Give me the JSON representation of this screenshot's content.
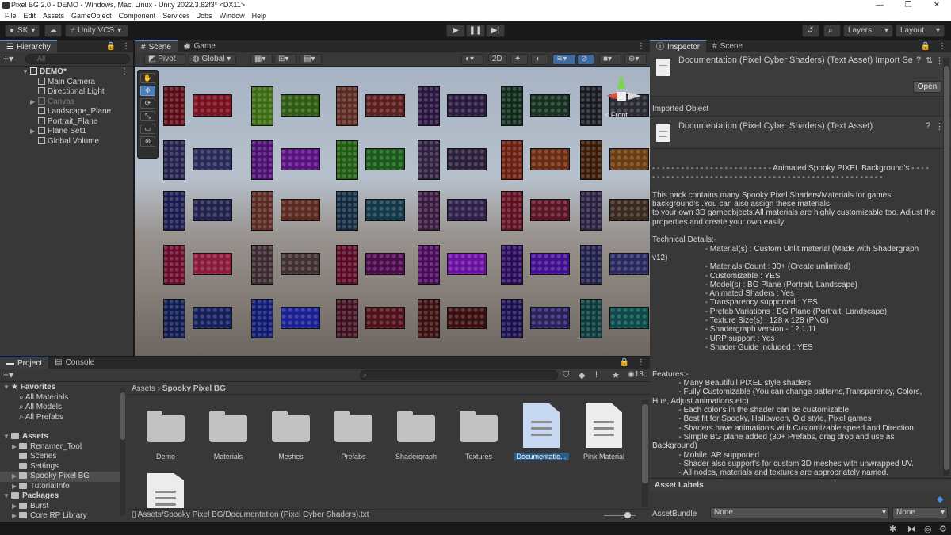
{
  "window": {
    "title": "Pixel BG 2.0 - DEMO - Windows, Mac, Linux - Unity 2022.3.62f3* <DX11>",
    "controls": [
      "—",
      "❐",
      "✕"
    ]
  },
  "menu": [
    "File",
    "Edit",
    "Assets",
    "GameObject",
    "Component",
    "Services",
    "Jobs",
    "Window",
    "Help"
  ],
  "toolbar": {
    "account": "SK",
    "vcs": "Unity VCS",
    "layers": "Layers",
    "layout": "Layout"
  },
  "hierarchy": {
    "tab": "Hierarchy",
    "search_placeholder": "All",
    "root": "DEMO*",
    "items": [
      "Main Camera",
      "Directional Light",
      "Canvas",
      "Landscape_Plane",
      "Portrait_Plane",
      "Plane Set1",
      "Global Volume"
    ]
  },
  "scene": {
    "tabs": [
      "Scene",
      "Game"
    ],
    "pivot": "Pivot",
    "global": "Global",
    "mode_2d": "2D",
    "gizmo_label": "< Front",
    "tiles": [
      [
        "#5a0a14",
        "#7a1020"
      ],
      [
        "#3b6b10",
        "#2e5a12"
      ],
      [
        "#5a2a22",
        "#5c1e1e"
      ],
      [
        "#2a1440",
        "#2b1a3f"
      ],
      [
        "#0f2a1a",
        "#163020"
      ],
      [
        "#1a1a22",
        "#2a2a33"
      ],
      [
        "#24204e",
        "#2a2a5a"
      ],
      [
        "#4a0f70",
        "#5a1080"
      ],
      [
        "#1f5a10",
        "#185a18"
      ],
      [
        "#302040",
        "#2a1f3a"
      ],
      [
        "#6a1f10",
        "#6a2a10"
      ],
      [
        "#3a1a05",
        "#6a3a10"
      ],
      [
        "#1a1a50",
        "#22224e"
      ],
      [
        "#5a2a22",
        "#5a2820"
      ],
      [
        "#122a40",
        "#123848"
      ],
      [
        "#3a1a40",
        "#30204a"
      ],
      [
        "#601020",
        "#5a1525"
      ],
      [
        "#2a2040",
        "#3a2a20"
      ],
      [
        "#6a0a2a",
        "#8a1a3a"
      ],
      [
        "#3a2a30",
        "#403030"
      ],
      [
        "#5a0a25",
        "#4a0a4a"
      ],
      [
        "#4a0a5a",
        "#6a10a0"
      ],
      [
        "#2a0a5a",
        "#401090"
      ],
      [
        "#20204a",
        "#2a2a60"
      ],
      [
        "#0f1a50",
        "#15205a"
      ],
      [
        "#101a70",
        "#1a2090"
      ],
      [
        "#401020",
        "#50101a"
      ],
      [
        "#3a1010",
        "#3a0f10"
      ],
      [
        "#1a1050",
        "#2a2060"
      ],
      [
        "#0a3a3a",
        "#0a4a4a"
      ]
    ]
  },
  "inspector": {
    "tabs": [
      "Inspector",
      "Scene"
    ],
    "header_title": "Documentation (Pixel Cyber Shaders) (Text Asset) Import Se",
    "open_button": "Open",
    "imported_object": "Imported Object",
    "object_title": "Documentation (Pixel Cyber Shaders) (Text Asset)",
    "doc_lines": [
      "- - - - - - - - - - - - - - - - - - - - - - - - - Animated Spooky PIXEL Background's - - - -",
      "- - - - - - - - - - - - - - - - - - - - - - - - - - - - - - - - - - - - - - - - - - - - - - - -",
      "",
      "This pack contains many Spooky Pixel Shaders/Materials for games",
      "background's .You can also assign these materials",
      "to your own 3D gameobjects.All materials are highly customizable too. Adjust the",
      "properties and create your own easily.",
      "",
      "Technical Details:-",
      "                        - Material(s) : Custom Unlit material (Made with Shadergraph",
      "v12)",
      "                        - Materials Count : 30+ (Create unlimited)",
      "                        - Customizable : YES",
      "                        - Model(s) : BG Plane (Portrait, Landscape)",
      "                        - Animated Shaders : Yes",
      "                        - Transparency supported : YES",
      "                        - Prefab Variations : BG Plane (Portrait, Landscape)",
      "                        - Texture Size(s) : 128 x 128 (PNG)",
      "                        - Shadergraph version - 12.1.11",
      "                        - URP support : Yes",
      "                        - Shader Guide included : YES",
      "",
      "",
      "Features:-",
      "            - Many Beautifull PIXEL style shaders",
      "            - Fully Customizable (You can change patterns,Transparency, Colors,",
      "Hue, Adjust animations.etc)",
      "            - Each color's in the shader can be customizable",
      "            - Best fit for Spooky, Halloween, Old style, Pixel games",
      "            - Shaders have animation's with Customizable speed and Direction",
      "            - Simple BG plane added (30+ Prefabs, drag drop and use as",
      "Background)",
      "            - Mobile, AR supported",
      "            - Shader also support's for custom 3D meshes with unwrapped UV.",
      "            - All nodes, materials and textures are appropriately named."
    ],
    "asset_labels": "Asset Labels",
    "assetbundle_label": "AssetBundle",
    "assetbundle_value": "None",
    "assetbundle_variant": "None"
  },
  "project": {
    "tabs": [
      "Project",
      "Console"
    ],
    "favorites": "Favorites",
    "favorites_items": [
      "All Materials",
      "All Models",
      "All Prefabs"
    ],
    "assets": "Assets",
    "assets_items": [
      "Renamer_Tool",
      "Scenes",
      "Settings",
      "Spooky Pixel BG",
      "TutorialInfo"
    ],
    "packages": "Packages",
    "packages_items": [
      "Burst",
      "Core RP Library"
    ],
    "breadcrumb_root": "Assets",
    "breadcrumb_current": "Spooky Pixel BG",
    "count": "18",
    "folders": [
      "Demo",
      "Materials",
      "Meshes",
      "Prefabs",
      "Shadergraph",
      "Textures"
    ],
    "files": [
      "Documentatio...",
      "Pink Material"
    ],
    "path": "Assets/Spooky Pixel BG/Documentation (Pixel Cyber Shaders).txt"
  }
}
